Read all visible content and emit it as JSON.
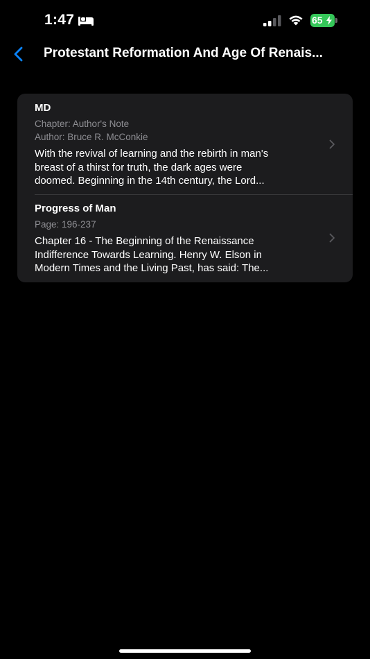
{
  "status_bar": {
    "time": "1:47",
    "battery_level": "65",
    "battery_color": "#35c759"
  },
  "nav": {
    "back_icon": "chevron-left-icon",
    "title": "Protestant Reformation And Age Of Renais..."
  },
  "results": [
    {
      "title": "MD",
      "meta": [
        "Chapter: Author's Note",
        "Author: Bruce R. McConkie"
      ],
      "snippet_lines": [
        "With the revival of learning and the rebirth in man's",
        "breast of a thirst for truth, the dark ages were",
        "doomed. Beginning in the 14th century, the Lord..."
      ]
    },
    {
      "title": "Progress of Man",
      "meta": [
        "Page: 196-237"
      ],
      "snippet_lines": [
        "Chapter 16 - The Beginning of the Renaissance",
        "Indifference Towards Learning. Henry W. Elson in",
        "Modern Times and the Living Past, has said: The..."
      ]
    }
  ],
  "colors": {
    "accent": "#0a84ff",
    "card_background": "#1c1c1e",
    "secondary_text": "#8e8e93"
  }
}
